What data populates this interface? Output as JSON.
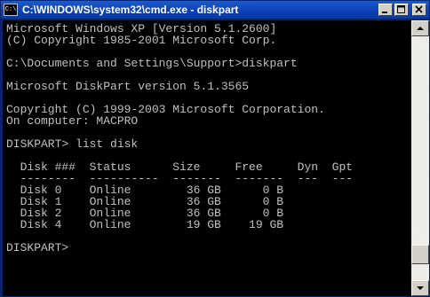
{
  "window": {
    "title": "C:\\WINDOWS\\system32\\cmd.exe - diskpart",
    "icon": "cmd-icon",
    "icon_text": "C:\\",
    "controls": [
      "minimize-icon",
      "maximize-icon",
      "close-icon"
    ]
  },
  "console": {
    "lines": [
      "Microsoft Windows XP [Version 5.1.2600]",
      "(C) Copyright 1985-2001 Microsoft Corp.",
      "",
      "C:\\Documents and Settings\\Support>diskpart",
      "",
      "Microsoft DiskPart version 5.1.3565",
      "",
      "Copyright (C) 1999-2003 Microsoft Corporation.",
      "On computer: MACPRO",
      "",
      "DISKPART> list disk",
      "",
      "  Disk ###  Status      Size     Free     Dyn  Gpt",
      "  --------  ----------  -------  -------  ---  ---",
      "  Disk 0    Online        36 GB      0 B",
      "  Disk 1    Online        36 GB      0 B",
      "  Disk 2    Online        36 GB      0 B",
      "  Disk 4    Online        19 GB    19 GB",
      "",
      "DISKPART> "
    ]
  },
  "scrollbar": {
    "thumb_position": 0.93,
    "thumb_fraction": 0.08
  }
}
